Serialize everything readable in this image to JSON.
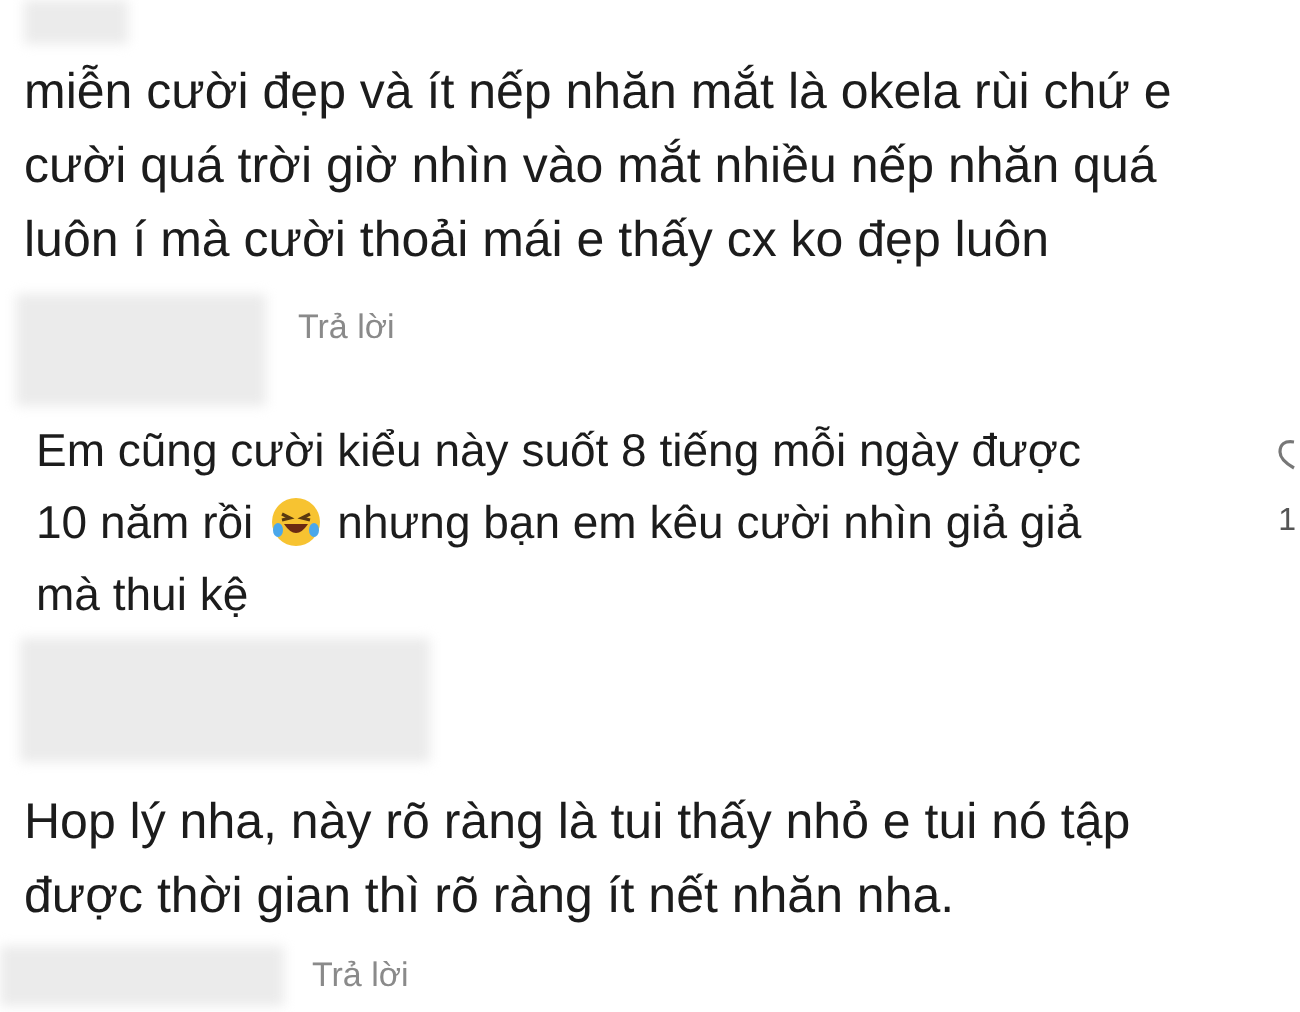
{
  "comments": [
    {
      "lines": [
        [
          {
            "kind": "text",
            "text": "miễn cười đẹp và ít nếp nhăn mắt là okela rùi chứ e"
          }
        ],
        [
          {
            "kind": "text",
            "text": "cười quá trời giờ nhìn vào mắt nhiều nếp nhăn quá"
          }
        ],
        [
          {
            "kind": "text",
            "text": "luôn í mà cười thoải mái e thấy cx ko đẹp luôn"
          }
        ]
      ],
      "reply": "Trả lời"
    },
    {
      "lines": [
        [
          {
            "kind": "text",
            "text": "Em cũng cười kiểu này suốt 8 tiếng mỗi ngày được"
          }
        ],
        [
          {
            "kind": "text",
            "text": "10 năm rồi"
          },
          {
            "kind": "emoji"
          },
          {
            "kind": "text",
            "text": "nhưng bạn em kêu cười nhìn giả giả"
          }
        ],
        [
          {
            "kind": "text",
            "text": "mà thui kệ"
          }
        ]
      ],
      "reaction_count": "1"
    },
    {
      "lines": [
        [
          {
            "kind": "text",
            "text": "Hop lý nha, này rõ ràng là tui thấy nhỏ e tui nó tập"
          }
        ],
        [
          {
            "kind": "text",
            "text": "được thời gian thì rõ ràng ít nết nhăn nha."
          }
        ]
      ],
      "reply": "Trả lời"
    }
  ]
}
